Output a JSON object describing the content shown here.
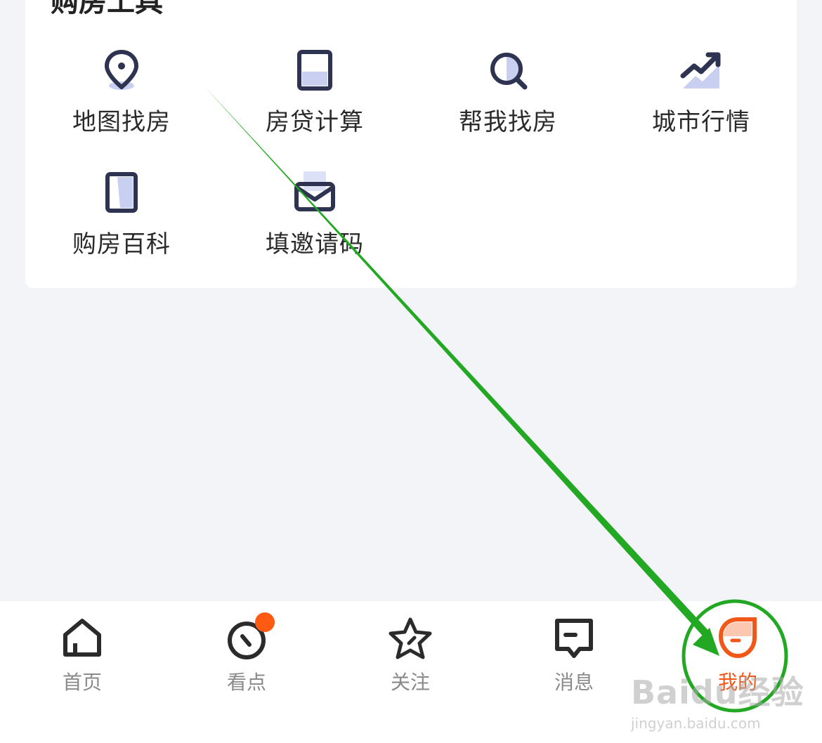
{
  "section": {
    "title": "购房工具"
  },
  "tools": [
    {
      "label": "地图找房",
      "icon": "map-pin-icon"
    },
    {
      "label": "房贷计算",
      "icon": "calculator-icon"
    },
    {
      "label": "帮我找房",
      "icon": "search-icon"
    },
    {
      "label": "城市行情",
      "icon": "trend-chart-icon"
    },
    {
      "label": "购房百科",
      "icon": "book-icon"
    },
    {
      "label": "填邀请码",
      "icon": "envelope-icon"
    }
  ],
  "tabbar": {
    "items": [
      {
        "label": "首页",
        "icon": "home-icon"
      },
      {
        "label": "看点",
        "icon": "compass-icon",
        "badge": true
      },
      {
        "label": "关注",
        "icon": "star-icon"
      },
      {
        "label": "消息",
        "icon": "message-icon"
      },
      {
        "label": "我的",
        "icon": "profile-icon",
        "active": true
      }
    ]
  },
  "watermark": {
    "main": "Baidu经验",
    "sub": "jingyan.baidu.com"
  },
  "colors": {
    "accent": "#f2571a",
    "icon_dark": "#2d3350",
    "icon_light": "#c9cff0",
    "annotation_green": "#23a823",
    "background": "#f3f4f8"
  }
}
